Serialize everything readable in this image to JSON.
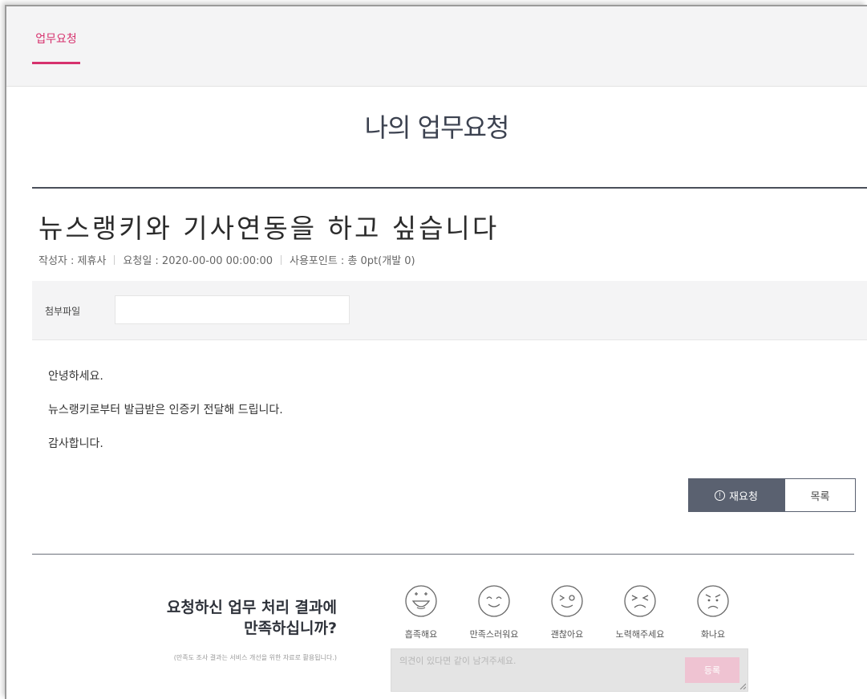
{
  "tabs": [
    {
      "label": "업무요청",
      "active": true
    }
  ],
  "page_title": "나의 업무요청",
  "post": {
    "title": "뉴스랭키와 기사연동을 하고 싶습니다",
    "meta": {
      "author": "작성자 : 제휴사",
      "date": "요청일 : 2020-00-00 00:00:00",
      "points": "사용포인트 : 총 0pt(개발 0)"
    },
    "attachment_label": "첨부파일",
    "body": [
      "안녕하세요.",
      "뉴스랭키로부터 발급받은 인증키 전달해 드립니다.",
      "감사합니다."
    ]
  },
  "actions": {
    "reask_label": "재요청",
    "list_label": "목록"
  },
  "survey": {
    "question_line1": "요청하신 업무 처리 결과에",
    "question_line2": "만족하십니까?",
    "note": "(만족도 조사 결과는 서비스 개선을 위한 자료로 활용됩니다.)",
    "options": [
      "흡족해요",
      "만족스러워요",
      "괜찮아요",
      "노력해주세요",
      "화나요"
    ],
    "placeholder": "의견이 있다면 같이 남겨주세요.",
    "submit_label": "등록"
  },
  "colors": {
    "accent": "#d6316d",
    "button_dark": "#5a6170",
    "submit_light": "#efc3d2"
  }
}
